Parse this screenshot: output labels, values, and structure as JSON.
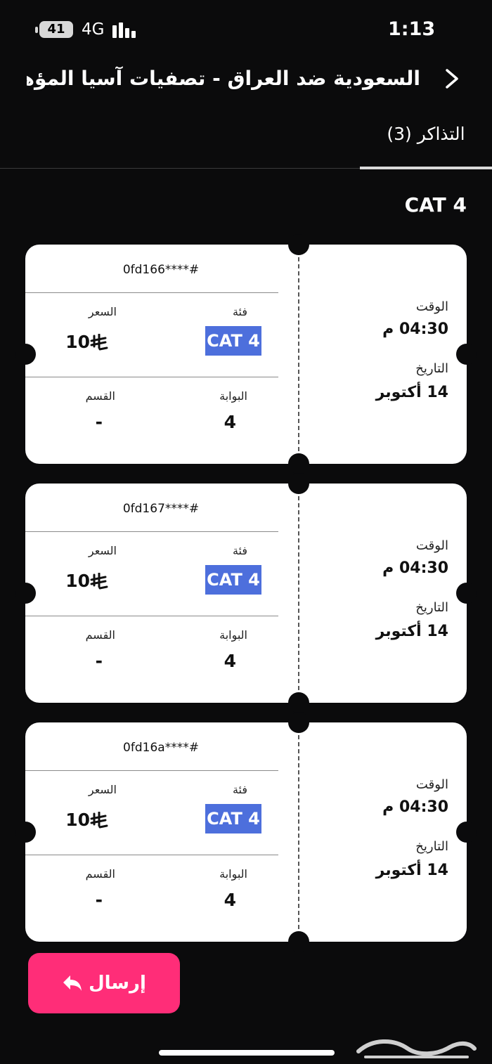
{
  "status_bar": {
    "battery": "41",
    "network": "4G",
    "time": "1:13"
  },
  "header": {
    "title": "السعودية ضد العراق - تصفيات آسيا المؤهلة...",
    "back_icon": "chevron-right-icon"
  },
  "tabs": [
    {
      "label": "التذاكر (3)",
      "active": true
    }
  ],
  "section_title": "CAT 4",
  "labels": {
    "price": "السعر",
    "category": "فئة",
    "section": "القسم",
    "gate": "البوابة",
    "time": "الوقت",
    "date": "التاريخ"
  },
  "tickets": [
    {
      "id": "0fd166****#",
      "price": "10",
      "category": "CAT 4",
      "section": "-",
      "gate": "4",
      "time": "04:30 م",
      "date": "14 أكتوبر"
    },
    {
      "id": "0fd167****#",
      "price": "10",
      "category": "CAT 4",
      "section": "-",
      "gate": "4",
      "time": "04:30 م",
      "date": "14 أكتوبر"
    },
    {
      "id": "0fd16a****#",
      "price": "10",
      "category": "CAT 4",
      "section": "-",
      "gate": "4",
      "time": "04:30 م",
      "date": "14 أكتوبر"
    }
  ],
  "send_button": {
    "label": "إرسال",
    "icon": "reply-arrow-icon"
  },
  "watermark": {
    "text": "حراج"
  },
  "colors": {
    "background": "#0b0b0c",
    "ticket": "#ffffff",
    "badge": "#4d6fdc",
    "send": "#ff2d78"
  }
}
